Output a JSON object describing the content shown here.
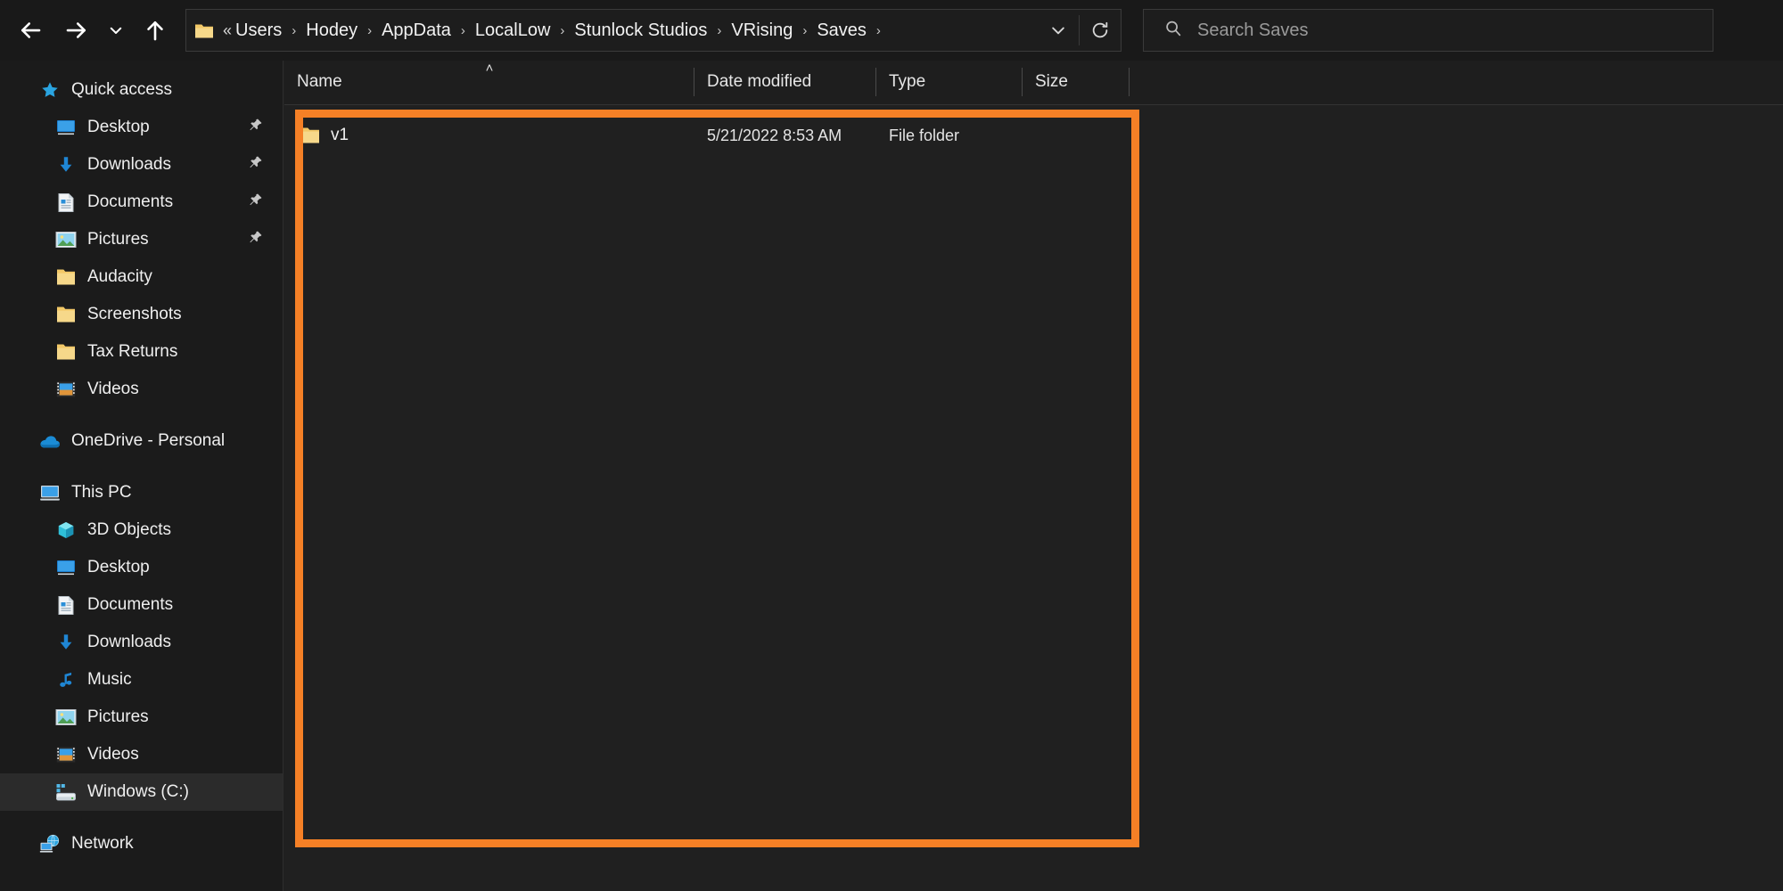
{
  "window": {
    "app": "File Explorer",
    "background_color": "#202020",
    "accent_color": "#f58026"
  },
  "toolbar": {
    "back_label": "Back",
    "forward_label": "Forward",
    "recent_label": "Recent locations",
    "up_label": "Up",
    "dropdown_label": "Previous locations",
    "refresh_label": "Refresh"
  },
  "address": {
    "prefix": "«",
    "breadcrumbs": [
      {
        "label": "Users"
      },
      {
        "label": "Hodey"
      },
      {
        "label": "AppData"
      },
      {
        "label": "LocalLow"
      },
      {
        "label": "Stunlock Studios"
      },
      {
        "label": "VRising"
      },
      {
        "label": "Saves"
      }
    ],
    "separator": "›"
  },
  "search": {
    "placeholder": "Search Saves",
    "value": "",
    "icon": "search-icon"
  },
  "sidebar": {
    "groups": [
      {
        "name": "quick-access",
        "items": [
          {
            "label": "Quick access",
            "icon": "star-icon",
            "indent": 1,
            "pinned": false,
            "selected": false
          },
          {
            "label": "Desktop",
            "icon": "desktop-icon",
            "indent": 2,
            "pinned": true,
            "selected": false
          },
          {
            "label": "Downloads",
            "icon": "download-icon",
            "indent": 2,
            "pinned": true,
            "selected": false
          },
          {
            "label": "Documents",
            "icon": "document-icon",
            "indent": 2,
            "pinned": true,
            "selected": false
          },
          {
            "label": "Pictures",
            "icon": "pictures-icon",
            "indent": 2,
            "pinned": true,
            "selected": false
          },
          {
            "label": "Audacity",
            "icon": "folder-icon",
            "indent": 2,
            "pinned": false,
            "selected": false
          },
          {
            "label": "Screenshots",
            "icon": "folder-icon",
            "indent": 2,
            "pinned": false,
            "selected": false
          },
          {
            "label": "Tax Returns",
            "icon": "folder-icon",
            "indent": 2,
            "pinned": false,
            "selected": false
          },
          {
            "label": "Videos",
            "icon": "videos-icon",
            "indent": 2,
            "pinned": false,
            "selected": false
          }
        ]
      },
      {
        "name": "onedrive",
        "items": [
          {
            "label": "OneDrive - Personal",
            "icon": "cloud-icon",
            "indent": 1,
            "pinned": false,
            "selected": false
          }
        ]
      },
      {
        "name": "this-pc",
        "items": [
          {
            "label": "This PC",
            "icon": "pc-icon",
            "indent": 1,
            "pinned": false,
            "selected": false
          },
          {
            "label": "3D Objects",
            "icon": "3d-objects-icon",
            "indent": 2,
            "pinned": false,
            "selected": false
          },
          {
            "label": "Desktop",
            "icon": "desktop-icon",
            "indent": 2,
            "pinned": false,
            "selected": false
          },
          {
            "label": "Documents",
            "icon": "document-icon",
            "indent": 2,
            "pinned": false,
            "selected": false
          },
          {
            "label": "Downloads",
            "icon": "download-icon",
            "indent": 2,
            "pinned": false,
            "selected": false
          },
          {
            "label": "Music",
            "icon": "music-icon",
            "indent": 2,
            "pinned": false,
            "selected": false
          },
          {
            "label": "Pictures",
            "icon": "pictures-icon",
            "indent": 2,
            "pinned": false,
            "selected": false
          },
          {
            "label": "Videos",
            "icon": "videos-icon",
            "indent": 2,
            "pinned": false,
            "selected": false
          },
          {
            "label": "Windows (C:)",
            "icon": "drive-icon",
            "indent": 2,
            "pinned": false,
            "selected": true
          }
        ]
      },
      {
        "name": "network",
        "items": [
          {
            "label": "Network",
            "icon": "network-icon",
            "indent": 1,
            "pinned": false,
            "selected": false
          }
        ]
      }
    ]
  },
  "columns": [
    {
      "key": "name",
      "label": "Name",
      "sorted": true,
      "sort_caret": "˄"
    },
    {
      "key": "date",
      "label": "Date modified",
      "sorted": false,
      "sort_caret": ""
    },
    {
      "key": "type",
      "label": "Type",
      "sorted": false,
      "sort_caret": ""
    },
    {
      "key": "size",
      "label": "Size",
      "sorted": false,
      "sort_caret": ""
    }
  ],
  "files": [
    {
      "name": "v1",
      "date_modified": "5/21/2022 8:53 AM",
      "type": "File folder",
      "size": "",
      "icon": "folder-icon"
    }
  ],
  "annotation": {
    "shape": "rectangle",
    "color": "#f58026",
    "label": "file-list-highlight"
  }
}
